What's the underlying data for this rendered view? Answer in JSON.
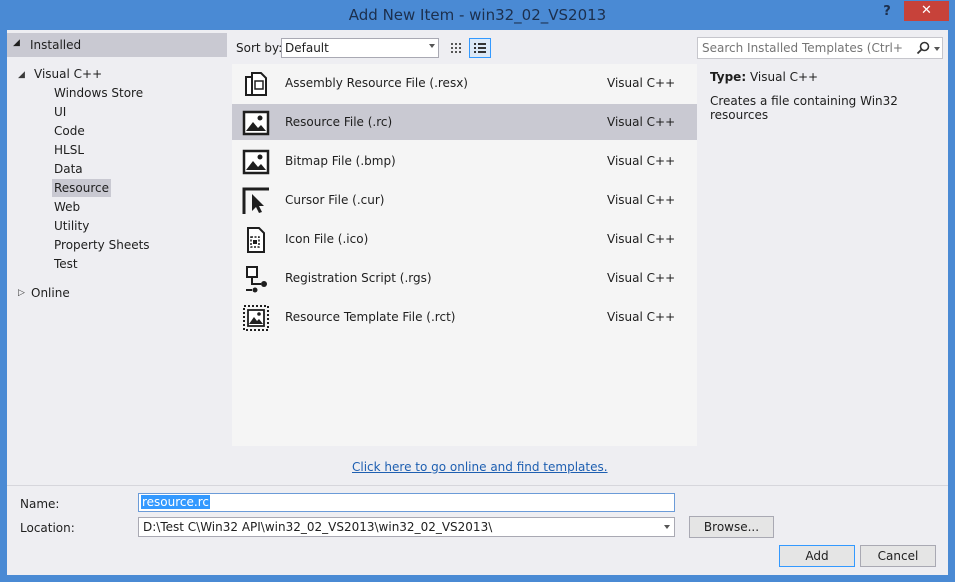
{
  "window": {
    "title": "Add New Item - win32_02_VS2013",
    "help": "?",
    "close": "✕"
  },
  "tree": {
    "installed": "Installed",
    "visual_cpp": "Visual C++",
    "children": [
      "Windows Store",
      "UI",
      "Code",
      "HLSL",
      "Data",
      "Resource",
      "Web",
      "Utility",
      "Property Sheets",
      "Test"
    ],
    "selected": "Resource",
    "online": "Online"
  },
  "toolbar": {
    "sort_label": "Sort by:",
    "sort_value": "Default",
    "search_placeholder": "Search Installed Templates (Ctrl+E)"
  },
  "templates": [
    {
      "name": "Assembly Resource File (.resx)",
      "lang": "Visual C++",
      "icon": "resx-file-icon"
    },
    {
      "name": "Resource File (.rc)",
      "lang": "Visual C++",
      "icon": "image-file-icon"
    },
    {
      "name": "Bitmap File (.bmp)",
      "lang": "Visual C++",
      "icon": "bitmap-icon"
    },
    {
      "name": "Cursor File (.cur)",
      "lang": "Visual C++",
      "icon": "cursor-icon"
    },
    {
      "name": "Icon File (.ico)",
      "lang": "Visual C++",
      "icon": "icon-file-icon"
    },
    {
      "name": "Registration Script (.rgs)",
      "lang": "Visual C++",
      "icon": "registration-script-icon"
    },
    {
      "name": "Resource Template File (.rct)",
      "lang": "Visual C++",
      "icon": "resource-template-icon"
    }
  ],
  "selected_template": "Resource File (.rc)",
  "details": {
    "type_label": "Type:",
    "type_value": "Visual C++",
    "description": "Creates a file containing Win32 resources"
  },
  "online_link": "Click here to go online and find templates.",
  "form": {
    "name_label": "Name:",
    "name_value": "resource.rc",
    "location_label": "Location:",
    "location_value": "D:\\Test C\\Win32 API\\win32_02_VS2013\\win32_02_VS2013\\",
    "browse": "Browse...",
    "add": "Add",
    "cancel": "Cancel"
  },
  "colors": {
    "titlebar": "#4a8ad4",
    "selection": "#c9c9d2",
    "close": "#c7423a",
    "link": "#1e5fb1"
  }
}
